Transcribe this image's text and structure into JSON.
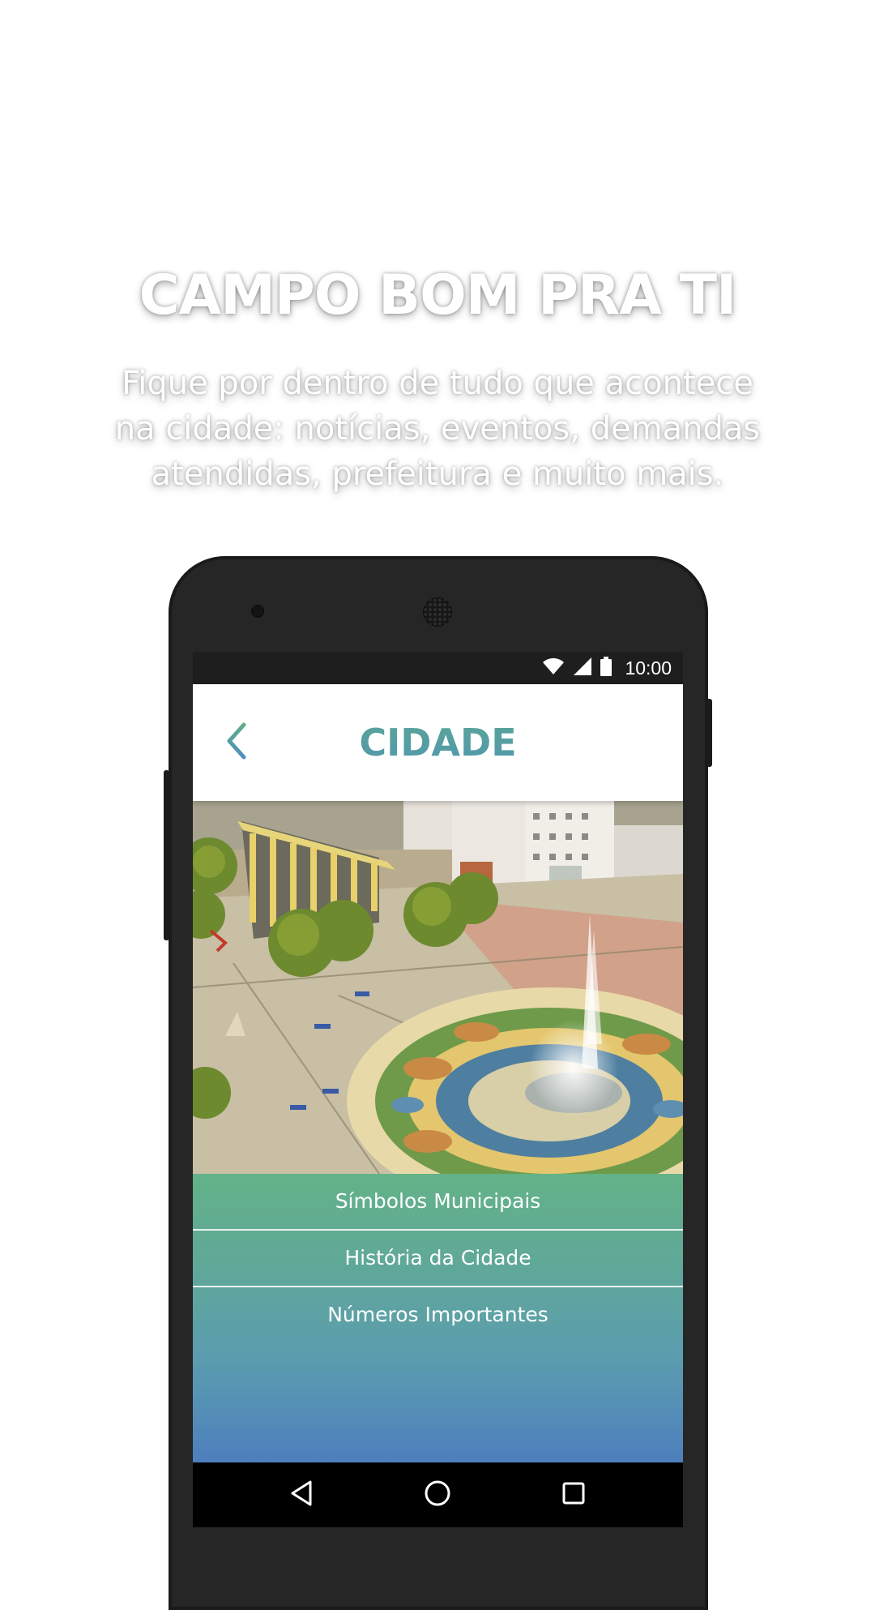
{
  "promo": {
    "title": "CAMPO BOM PRA TI",
    "line1": "Fique por dentro de tudo que acontece",
    "line2": "na cidade: notícias, eventos, demandas",
    "line3": "atendidas, prefeitura e muito mais."
  },
  "status_bar": {
    "time": "10:00",
    "icons": [
      "wifi-icon",
      "signal-icon",
      "battery-icon"
    ]
  },
  "header": {
    "title": "CIDADE",
    "back_icon": "chevron-left-icon"
  },
  "menu": {
    "items": [
      {
        "label": "Símbolos Municipais"
      },
      {
        "label": "História da Cidade"
      },
      {
        "label": "Números Importantes"
      }
    ]
  },
  "navbar": {
    "icons": [
      "back-triangle-icon",
      "home-circle-icon",
      "recents-square-icon"
    ]
  },
  "colors": {
    "gradient_top": "#63b288",
    "gradient_bottom": "#4d7fbd",
    "header_title_top": "#5dae86",
    "header_title_bottom": "#4e8ec0",
    "phone_body": "#262626"
  }
}
